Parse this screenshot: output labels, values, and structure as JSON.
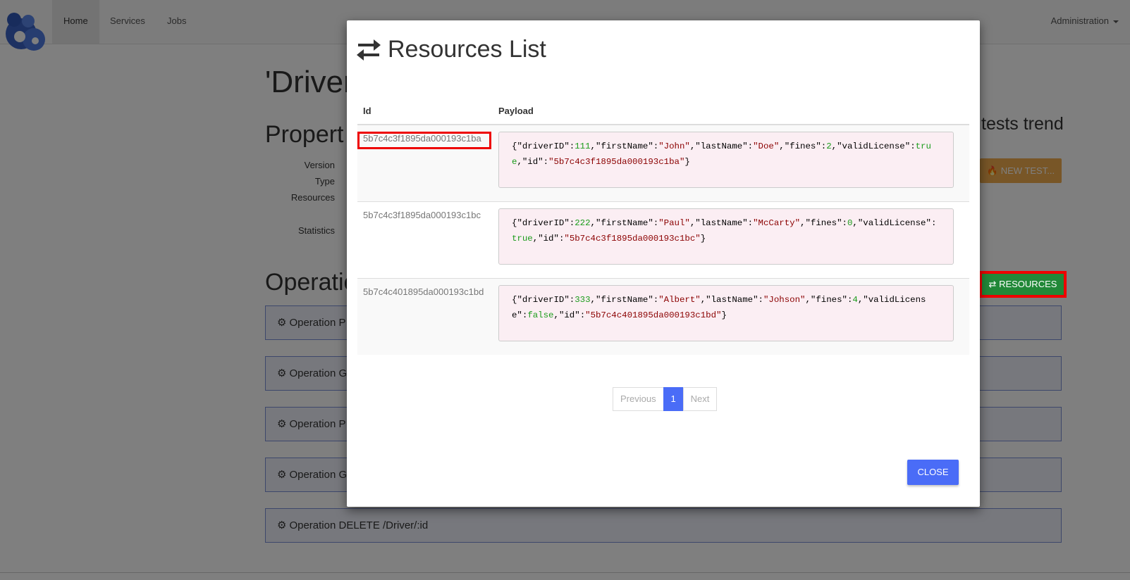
{
  "navbar": {
    "items": [
      {
        "label": "Home",
        "active": true
      },
      {
        "label": "Services",
        "active": false
      },
      {
        "label": "Jobs",
        "active": false
      }
    ],
    "admin_label": "Administration"
  },
  "background": {
    "title": "'Driver",
    "properties_heading": "Propert",
    "property_labels": [
      "Version",
      "Type",
      "Resources",
      "Statistics"
    ],
    "operations_heading": "Operatio",
    "trend_label": "tests trend",
    "new_test_label": "NEW TEST...",
    "resources_label": "RESOURCES",
    "operations": [
      "Operation P",
      "Operation G",
      "Operation P",
      "Operation G",
      "Operation DELETE /Driver/:id"
    ]
  },
  "modal": {
    "title": "Resources List",
    "columns": [
      "Id",
      "Payload"
    ],
    "rows": [
      {
        "id": "5b7c4c3f1895da000193c1ba",
        "driverID": "111",
        "firstName": "John",
        "lastName": "Doe",
        "fines": "2",
        "validLicense": "true"
      },
      {
        "id": "5b7c4c3f1895da000193c1bc",
        "driverID": "222",
        "firstName": "Paul",
        "lastName": "McCarty",
        "fines": "0",
        "validLicense": "true"
      },
      {
        "id": "5b7c4c401895da000193c1bd",
        "driverID": "333",
        "firstName": "Albert",
        "lastName": "Johson",
        "fines": "4",
        "validLicense": "false"
      }
    ],
    "pagination": {
      "previous": "Previous",
      "current": "1",
      "next": "Next"
    },
    "close_label": "CLOSE"
  },
  "colors": {
    "primary": "#4a6cf7",
    "success": "#218838",
    "warning": "#f0ad4e",
    "highlight": "#ee0000"
  },
  "icons": [
    "logo-icon",
    "exchange-icon",
    "fire-icon",
    "cog-icon",
    "caret-down-icon"
  ]
}
